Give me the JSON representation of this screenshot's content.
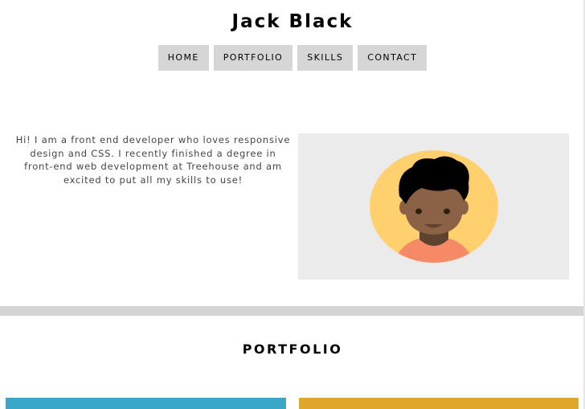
{
  "header": {
    "title": "Jack Black"
  },
  "nav": {
    "items": [
      {
        "label": "HOME"
      },
      {
        "label": "PORTFOLIO"
      },
      {
        "label": "SKILLS"
      },
      {
        "label": "CONTACT"
      }
    ]
  },
  "intro": {
    "text": "Hi! I am a front end developer who loves responsive design and CSS. I recently finished a degree in front-end web development at Treehouse and am excited to put all my skills to use!",
    "avatar_icon": "avatar-icon"
  },
  "portfolio": {
    "heading": "PORTFOLIO"
  },
  "colors": {
    "nav_bg": "#d6d6d6",
    "avatar_panel_bg": "#ebebeb",
    "avatar_circle": "#ffd06d",
    "skin": "#8b6246",
    "shirt": "#f68a66",
    "hair": "#000000",
    "card_blue": "#3aa7c9",
    "card_gold": "#dea72c",
    "divider": "#d4d4d4"
  }
}
